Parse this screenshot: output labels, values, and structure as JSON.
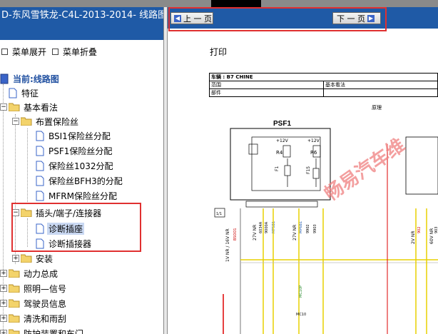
{
  "app": {
    "title": "D-东风雪铁龙-C4L-2013-2014- 线路图."
  },
  "controls": {
    "expand_label": "菜单展开",
    "collapse_label": "菜单折叠"
  },
  "tree": {
    "current": "当前:线路图",
    "items": [
      {
        "label": "特征"
      },
      {
        "label": "基本看法"
      },
      {
        "label": "布置保险丝"
      },
      {
        "label": "BSI1保险丝分配"
      },
      {
        "label": "PSF1保险丝分配"
      },
      {
        "label": "保险丝1032分配"
      },
      {
        "label": "保险丝BFH3的分配"
      },
      {
        "label": "MFRM保险丝分配"
      },
      {
        "label": "插头/端子/连接器"
      },
      {
        "label": "诊断插座"
      },
      {
        "label": "诊断插接器"
      },
      {
        "label": "安装"
      },
      {
        "label": "动力总成"
      },
      {
        "label": "照明—信号"
      },
      {
        "label": "驾驶员信息"
      },
      {
        "label": "清洗和雨刮"
      },
      {
        "label": "防护装置和车门"
      }
    ]
  },
  "nav": {
    "prev_label": "上 一 页",
    "next_label": "下 一 页"
  },
  "document": {
    "print_label": "打印",
    "vehicle_label": "车辆 : B7 CHINE",
    "range_label": "范围",
    "basic_view_label": "基本看法",
    "part_label": "部件",
    "schematic_label": "原理",
    "component_label": "PSF1",
    "fuse_f1": "F1",
    "fuse_f15": "F15",
    "relay_r4": "R4",
    "relay_r6": "R6",
    "v12a": "+12V",
    "v12b": "+12V",
    "wire_labels": [
      "1V NR / 16V NR",
      "27V NR",
      "27V NR",
      "2V NR",
      "60V NR"
    ],
    "wire_codes": [
      "BSOO1",
      "6034A",
      "9000A",
      "MP5B1",
      "MP6B1",
      "9902",
      "9903",
      "1TL4",
      "902",
      "903",
      "902A",
      "903A",
      "9893",
      "9034A"
    ],
    "conn_label": "MC10P",
    "ground_label": "MC10",
    "connector_box": "1/1",
    "watermark": "畅易汽车维"
  },
  "colors": {
    "title_bg": "#1f5aa6",
    "highlight": "#e03030",
    "watermark": "#f08080",
    "selected_bg": "#c9d8f2"
  }
}
